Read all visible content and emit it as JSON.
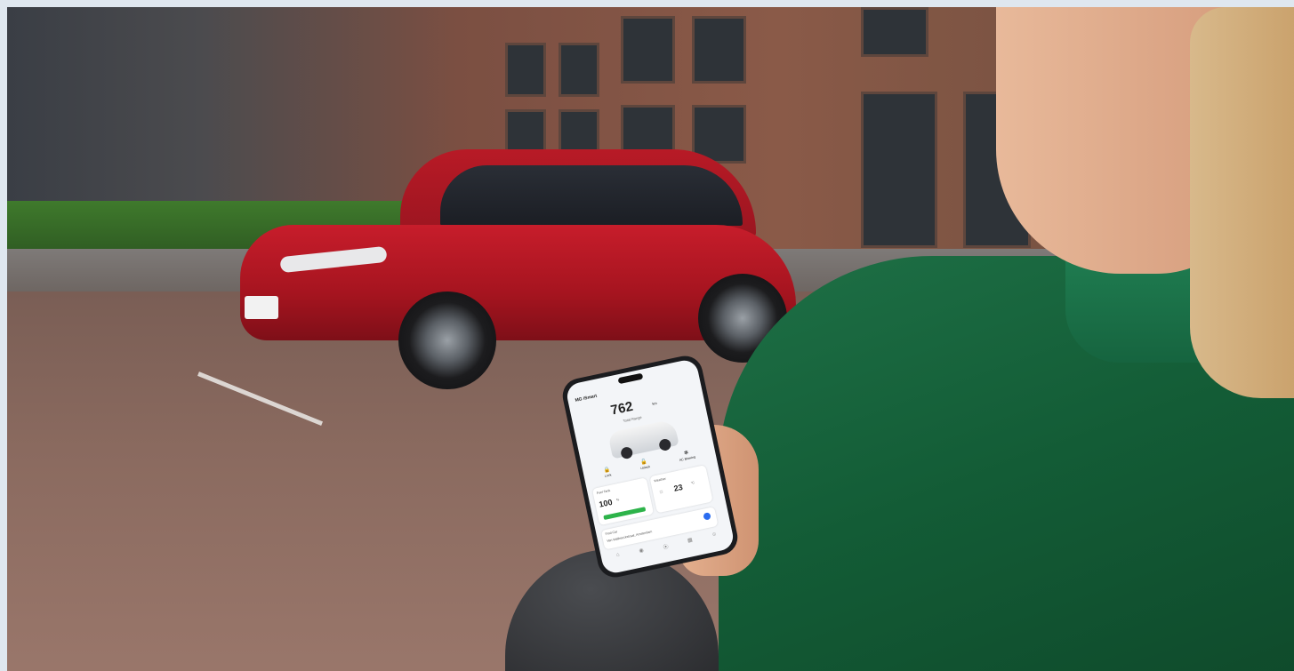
{
  "phone": {
    "app_title": "MG iSmart",
    "range_value": "762",
    "range_unit": "km",
    "range_label": "Total Range",
    "actions": [
      {
        "icon": "lock-icon",
        "glyph": "🔒",
        "label": "Lock"
      },
      {
        "icon": "unlock-icon",
        "glyph": "🔓",
        "label": "Unlock"
      },
      {
        "icon": "fan-icon",
        "glyph": "✻",
        "label": "AC Blowing"
      }
    ],
    "fuel": {
      "label": "Fuel Tank",
      "value": "100",
      "unit": "%"
    },
    "weather": {
      "label": "Weather",
      "value": "23",
      "unit": "°C"
    },
    "find_car": {
      "label": "Find Car",
      "address": "Van Walbeeckstraat, Amsterdam"
    },
    "nav_icons": [
      "home-icon",
      "car-icon",
      "location-icon",
      "services-icon",
      "profile-icon"
    ],
    "colors": {
      "fuel_bar": "#2db34a",
      "accent": "#2a6cf0"
    }
  }
}
